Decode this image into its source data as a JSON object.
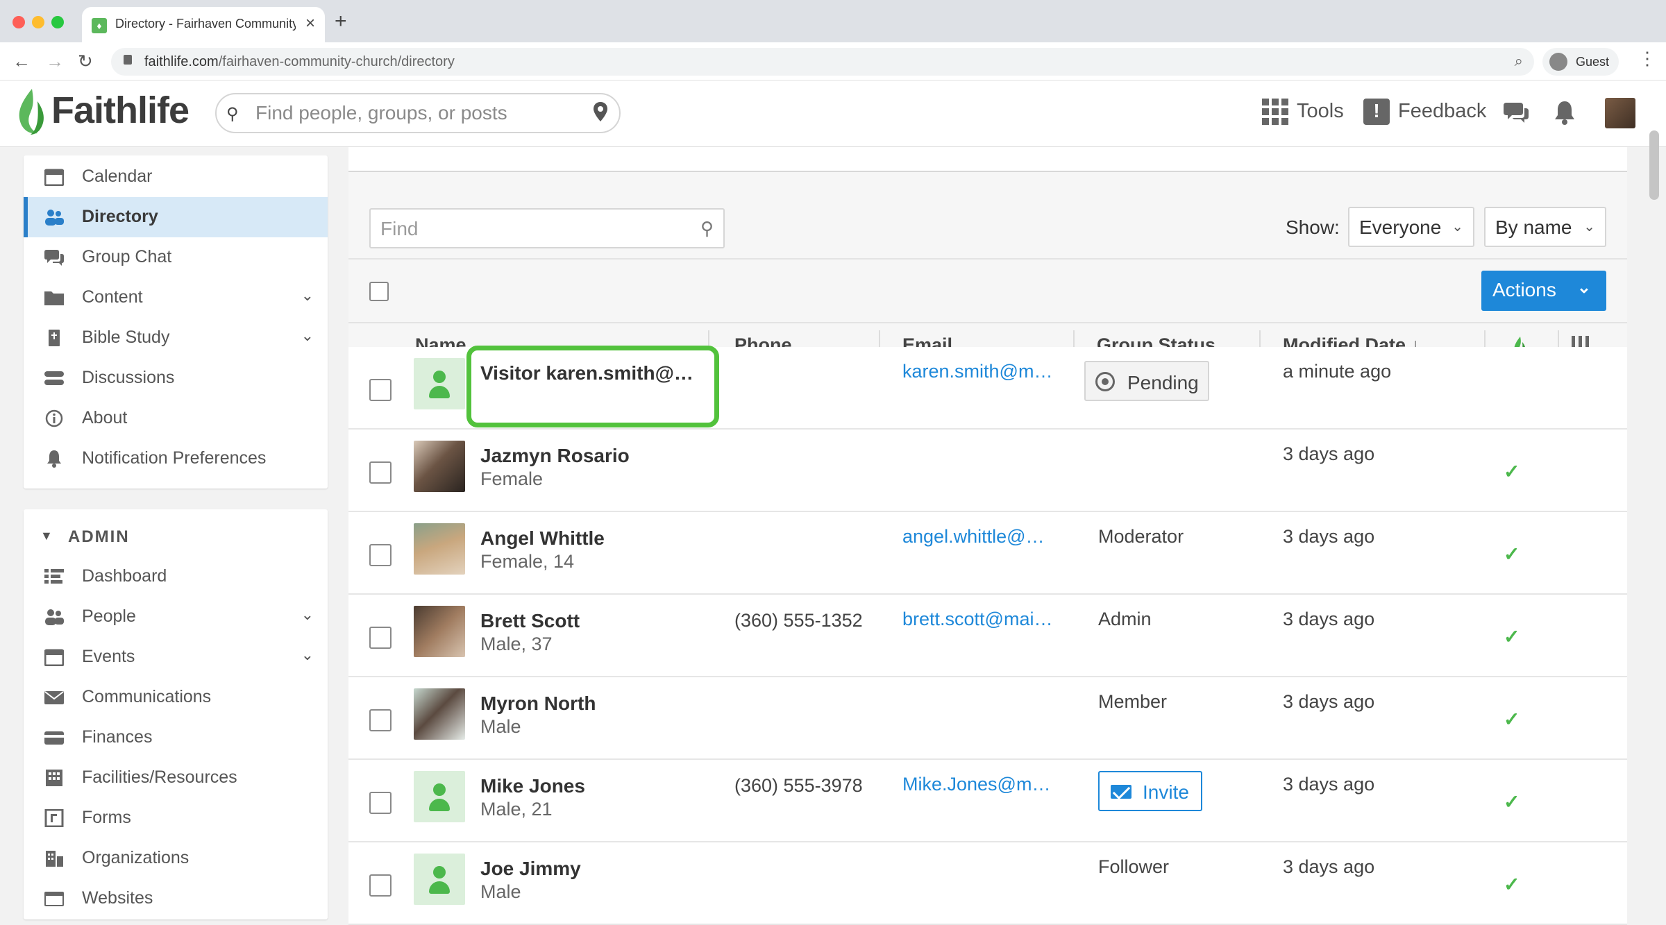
{
  "browser": {
    "tab_title": "Directory - Fairhaven Community Church",
    "url_host": "faithlife.com",
    "url_path": "/fairhaven-community-church/directory",
    "profile_label": "Guest"
  },
  "header": {
    "logo_text": "Faithlife",
    "search_placeholder": "Find people, groups, or posts",
    "tools_label": "Tools",
    "feedback_label": "Feedback"
  },
  "sidebar": {
    "items": [
      {
        "label": "Calendar",
        "icon": "calendar-icon"
      },
      {
        "label": "Directory",
        "icon": "people-icon",
        "active": true
      },
      {
        "label": "Group Chat",
        "icon": "chat-icon"
      },
      {
        "label": "Content",
        "icon": "folder-icon",
        "expandable": true
      },
      {
        "label": "Bible Study",
        "icon": "bible-icon",
        "expandable": true
      },
      {
        "label": "Discussions",
        "icon": "discussions-icon"
      },
      {
        "label": "About",
        "icon": "info-icon"
      },
      {
        "label": "Notification Preferences",
        "icon": "bell-icon"
      }
    ],
    "admin_label": "ADMIN",
    "admin_items": [
      {
        "label": "Dashboard",
        "icon": "dashboard-icon"
      },
      {
        "label": "People",
        "icon": "people-icon",
        "expandable": true
      },
      {
        "label": "Events",
        "icon": "calendar-icon",
        "expandable": true
      },
      {
        "label": "Communications",
        "icon": "envelope-icon"
      },
      {
        "label": "Finances",
        "icon": "credit-card-icon"
      },
      {
        "label": "Facilities/Resources",
        "icon": "building-icon"
      },
      {
        "label": "Forms",
        "icon": "form-icon"
      },
      {
        "label": "Organizations",
        "icon": "organization-icon"
      },
      {
        "label": "Websites",
        "icon": "website-icon"
      }
    ]
  },
  "toolbar": {
    "find_placeholder": "Find",
    "show_label": "Show:",
    "show_value": "Everyone",
    "sort_value": "By name",
    "actions_label": "Actions"
  },
  "table": {
    "columns": {
      "name": "Name",
      "phone": "Phone",
      "email": "Email",
      "status": "Group Status",
      "modified": "Modified Date"
    },
    "rows": [
      {
        "name": "Visitor karen.smith@m…",
        "meta": "",
        "phone": "",
        "email": "karen.smith@m…",
        "status": "Pending",
        "modified": "a minute ago",
        "fl": false
      },
      {
        "name": "Jazmyn Rosario",
        "meta": "Female",
        "phone": "",
        "email": "",
        "status": "",
        "modified": "3 days ago",
        "fl": true
      },
      {
        "name": "Angel Whittle",
        "meta": "Female, 14",
        "phone": "",
        "email": "angel.whittle@…",
        "status": "Moderator",
        "modified": "3 days ago",
        "fl": true
      },
      {
        "name": "Brett Scott",
        "meta": "Male, 37",
        "phone": "(360) 555-1352",
        "email": "brett.scott@mai…",
        "status": "Admin",
        "modified": "3 days ago",
        "fl": true
      },
      {
        "name": "Myron North",
        "meta": "Male",
        "phone": "",
        "email": "",
        "status": "Member",
        "modified": "3 days ago",
        "fl": true
      },
      {
        "name": "Mike Jones",
        "meta": "Male, 21",
        "phone": "(360) 555-3978",
        "email": "Mike.Jones@m…",
        "status": "Invite",
        "modified": "3 days ago",
        "fl": true
      },
      {
        "name": "Joe Jimmy",
        "meta": "Male",
        "phone": "",
        "email": "",
        "status": "Follower",
        "modified": "3 days ago",
        "fl": true
      }
    ]
  },
  "colors": {
    "accent": "#1e88d9",
    "brand_green": "#4cb84c",
    "highlight": "#52c23c"
  }
}
